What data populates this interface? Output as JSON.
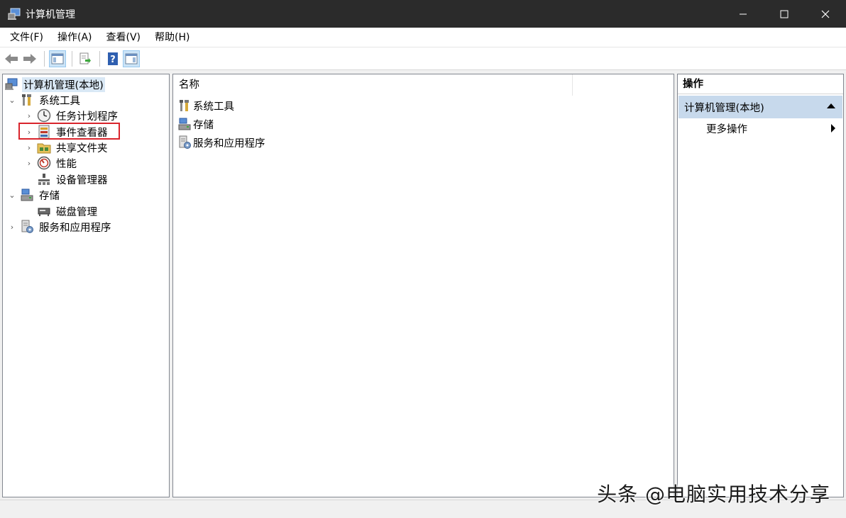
{
  "window": {
    "title": "计算机管理",
    "controls": {
      "minimize_icon": "minimize-icon",
      "maximize_icon": "maximize-icon",
      "close_icon": "close-icon"
    }
  },
  "menu": [
    "文件(F)",
    "操作(A)",
    "查看(V)",
    "帮助(H)"
  ],
  "toolbar": {
    "buttons": [
      "back-arrow-icon",
      "forward-arrow-icon",
      "show-hide-console-tree-icon",
      "export-list-icon",
      "help-icon",
      "show-hide-action-pane-icon"
    ]
  },
  "tree": {
    "root": "计算机管理(本地)",
    "items": [
      {
        "label": "系统工具",
        "expanded": true
      },
      {
        "label": "任务计划程序"
      },
      {
        "label": "事件查看器",
        "highlighted": true
      },
      {
        "label": "共享文件夹"
      },
      {
        "label": "性能"
      },
      {
        "label": "设备管理器"
      },
      {
        "label": "存储",
        "expanded": true
      },
      {
        "label": "磁盘管理"
      },
      {
        "label": "服务和应用程序"
      }
    ]
  },
  "list": {
    "column_name": "名称",
    "rows": [
      "系统工具",
      "存储",
      "服务和应用程序"
    ]
  },
  "actions": {
    "header": "操作",
    "group": "计算机管理(本地)",
    "more": "更多操作"
  },
  "watermark": "头条 @电脑实用技术分享",
  "colors": {
    "titlebar": "#2b2b2b",
    "selection": "#c7d9ec",
    "highlight_box": "#d9242c"
  }
}
